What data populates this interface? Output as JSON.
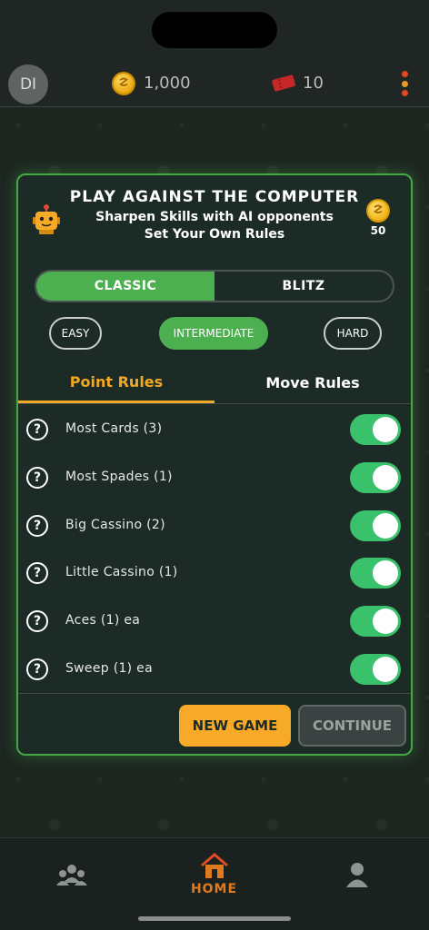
{
  "header": {
    "avatar_initials": "DI",
    "coins": "1,000",
    "tickets": "10"
  },
  "dialog": {
    "title": "PLAY AGAINST THE COMPUTER",
    "subtitle_line1": "Sharpen Skills with AI opponents",
    "subtitle_line2": "Set Your Own Rules",
    "reward": "50",
    "modes": [
      {
        "label": "CLASSIC",
        "active": true
      },
      {
        "label": "BLITZ",
        "active": false
      }
    ],
    "levels": {
      "easy": "EASY",
      "intermediate": "INTERMEDIATE",
      "hard": "HARD",
      "selected": "INTERMEDIATE"
    },
    "tabs": [
      {
        "label": "Point Rules",
        "active": true
      },
      {
        "label": "Move Rules",
        "active": false
      }
    ],
    "rules": [
      {
        "label": "Most Cards (3)",
        "enabled": true
      },
      {
        "label": "Most Spades (1)",
        "enabled": true
      },
      {
        "label": "Big Cassino (2)",
        "enabled": true
      },
      {
        "label": "Little Cassino (1)",
        "enabled": true
      },
      {
        "label": "Aces (1) ea",
        "enabled": true
      },
      {
        "label": "Sweep (1) ea",
        "enabled": true
      }
    ],
    "buttons": {
      "new_game": "NEW GAME",
      "continue": "CONTINUE"
    }
  },
  "nav": {
    "home_label": "HOME",
    "active": "home",
    "icons": [
      "friends-icon",
      "home-icon",
      "profile-icon"
    ]
  },
  "colors": {
    "accent_green": "#4caf50",
    "accent_orange": "#f2a825",
    "toggle_on": "#3ac16b"
  }
}
